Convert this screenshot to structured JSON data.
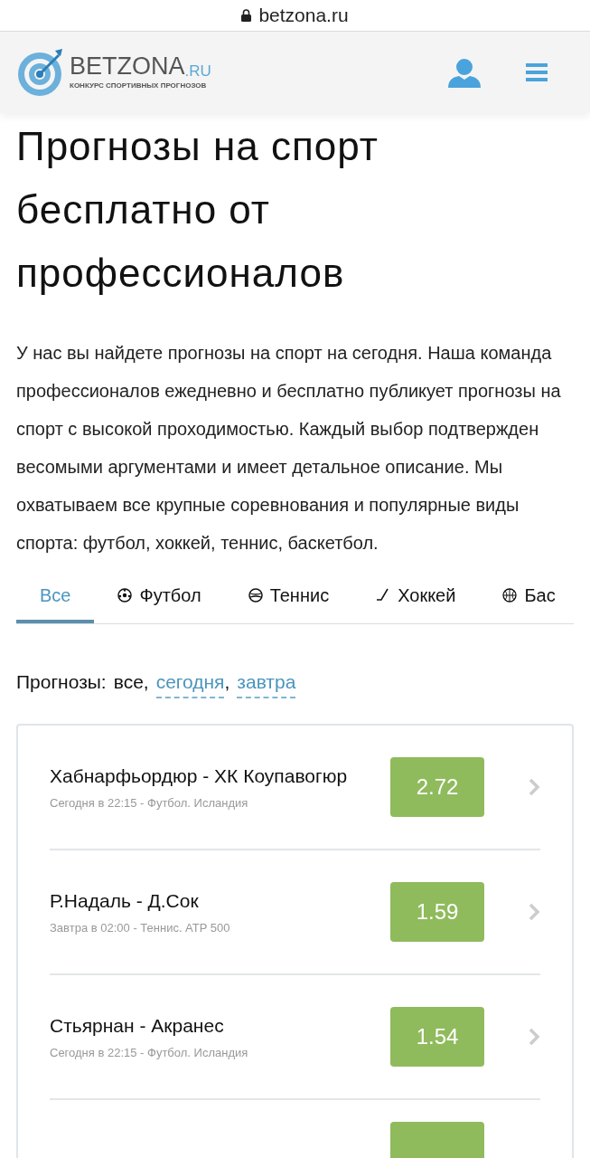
{
  "browser": {
    "url": "betzona.ru"
  },
  "header": {
    "logo_name": "BETZONA",
    "logo_tld": ".RU",
    "logo_tagline": "КОНКУРС СПОРТИВНЫХ ПРОГНОЗОВ"
  },
  "title": "Прогнозы на спорт бесплатно от профессионалов",
  "intro": "У нас вы найдете прогнозы на спорт на сегодня. Наша команда профессионалов ежедневно и бесплатно публикует прогнозы на спорт с высокой проходимостью. Каждый выбор подтвержден весомыми аргументами и имеет детальное описание. Мы охватываем все крупные соревнования и популярные виды спорта: футбол, хоккей, теннис, баскетбол.",
  "tabs": [
    {
      "label": "Все",
      "kind": "all",
      "selected": true
    },
    {
      "label": "Футбол",
      "kind": "football",
      "selected": false
    },
    {
      "label": "Теннис",
      "kind": "tennis",
      "selected": false
    },
    {
      "label": "Хоккей",
      "kind": "hockey",
      "selected": false
    },
    {
      "label": "Бас",
      "kind": "basketball",
      "selected": false
    }
  ],
  "filter": {
    "label": "Прогнозы:",
    "current": "все,",
    "links": [
      "сегодня",
      "завтра"
    ],
    "separator": ","
  },
  "predictions": [
    {
      "match": "Хабнарфьордюр - ХК Коупавогюр",
      "info": "Сегодня в 22:15 - Футбол. Исландия",
      "odds": "2.72"
    },
    {
      "match": "Р.Надаль - Д.Сок",
      "info": "Завтра в 02:00 - Теннис. ATP 500",
      "odds": "1.59"
    },
    {
      "match": "Стьярнан - Акранес",
      "info": "Сегодня в 22:15 - Футбол. Исландия",
      "odds": "1.54"
    }
  ]
}
